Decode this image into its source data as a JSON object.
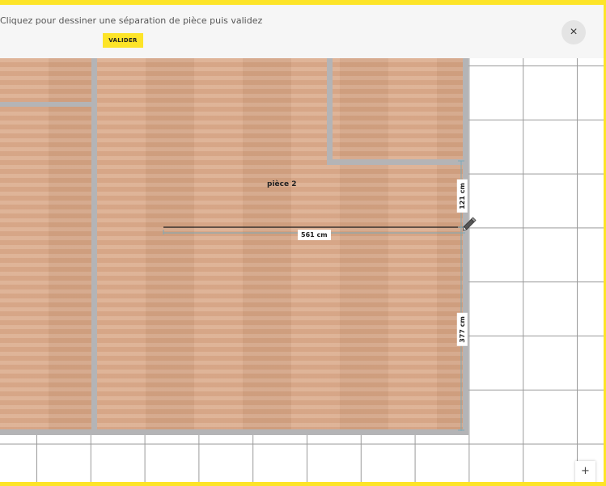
{
  "header": {
    "instruction": "Cliquez pour dessiner une séparation de pièce puis validez",
    "validate_label": "VALIDER",
    "close_icon": "×"
  },
  "plan": {
    "room_name": "pièce 2",
    "dimension_horizontal": "561 cm",
    "dimension_upper": "121 cm",
    "dimension_lower": "377 cm",
    "floor_material": "wood-parquet",
    "floor_color": "#d9a786",
    "wall_color": "#b4b4b6",
    "accent_color": "#fde428"
  },
  "zoom": {
    "in_label": "+",
    "out_label": "-"
  }
}
